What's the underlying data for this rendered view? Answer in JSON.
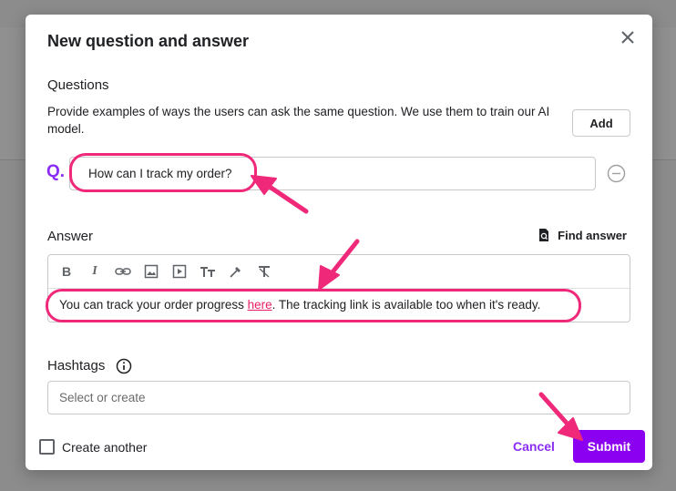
{
  "modal": {
    "title": "New question and answer",
    "close_icon": "close-icon"
  },
  "questions": {
    "label": "Questions",
    "help_text": "Provide examples of ways the users can ask the same question. We use them to train our AI model.",
    "add_label": "Add",
    "marker": "Q.",
    "items": [
      {
        "value": "How can I track my order?"
      }
    ],
    "remove_icon": "minus-circle-icon"
  },
  "answer": {
    "label": "Answer",
    "find_answer_label": "Find answer",
    "find_icon": "search-document-icon",
    "toolbar_icons": [
      "bold-icon",
      "italic-icon",
      "link-icon",
      "image-icon",
      "video-icon",
      "text-size-icon",
      "color-picker-icon",
      "clear-format-icon"
    ],
    "content_before": "You can track your order progress ",
    "content_link": "here",
    "content_after": ". The tracking link is available too when it's ready."
  },
  "hashtags": {
    "label": "Hashtags",
    "info_icon": "info-icon",
    "placeholder": "Select or create"
  },
  "footer": {
    "create_another_label": "Create another",
    "create_another_checked": false,
    "cancel_label": "Cancel",
    "submit_label": "Submit"
  },
  "colors": {
    "accent": "#8b00f0",
    "annotation": "#f0287a",
    "link": "#e91e63"
  }
}
